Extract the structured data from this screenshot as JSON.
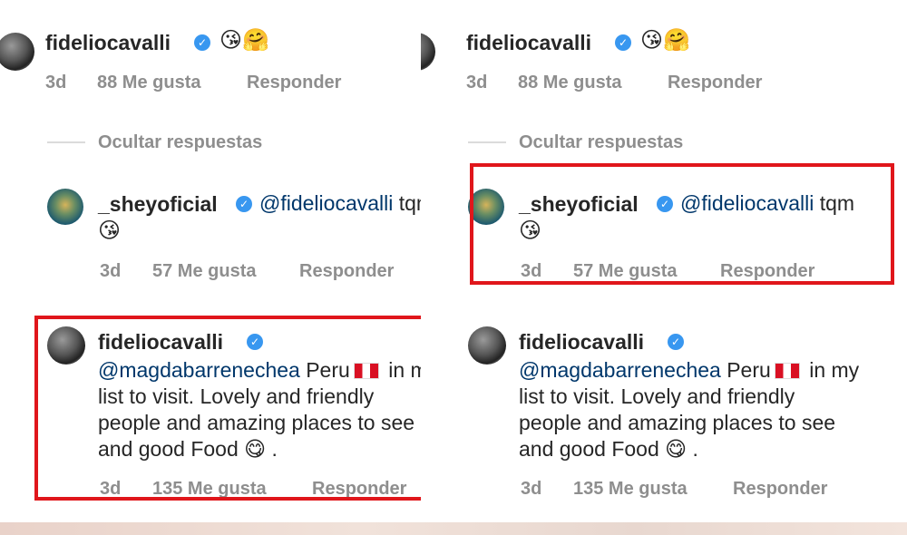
{
  "left": {
    "c1": {
      "user": "fideliocavalli",
      "emoji": "😘🤗",
      "time": "3d",
      "likes": "88 Me gusta",
      "reply": "Responder"
    },
    "hide": "Ocultar respuestas",
    "c2": {
      "user": "_sheyoficial",
      "mention": "@fideliocavalli",
      "text": " tqm",
      "emoji": "😘",
      "time": "3d",
      "likes": "57 Me gusta",
      "reply": "Responder"
    },
    "c3": {
      "user": "fideliocavalli",
      "mention": "@magdabarrenechea",
      "line1": " Peru",
      "line1b": " in my",
      "line2": "list to visit. Lovely and friendly",
      "line3": "people and amazing places to see",
      "line4": "and good Food",
      "line4b": " 😋 .",
      "time": "3d",
      "likes": "135 Me gusta",
      "reply": "Responder"
    }
  },
  "right": {
    "c1": {
      "user": "fideliocavalli",
      "emoji": "😘🤗",
      "time": "3d",
      "likes": "88 Me gusta",
      "reply": "Responder"
    },
    "hide": "Ocultar respuestas",
    "c2": {
      "user": "_sheyoficial",
      "mention": "@fideliocavalli",
      "text": " tqm",
      "emoji": "😘",
      "time": "3d",
      "likes": "57 Me gusta",
      "reply": "Responder"
    },
    "c3": {
      "user": "fideliocavalli",
      "mention": "@magdabarrenechea",
      "line1": " Peru",
      "line1b": " in my",
      "line2": "list to visit. Lovely and friendly",
      "line3": "people and amazing places to see",
      "line4": "and good Food",
      "line4b": " 😋 .",
      "time": "3d",
      "likes": "135 Me gusta",
      "reply": "Responder"
    }
  },
  "colors": {
    "highlight": "#e0161b",
    "verified": "#3897f0",
    "mention": "#00376b",
    "meta": "#8e8e8e"
  }
}
